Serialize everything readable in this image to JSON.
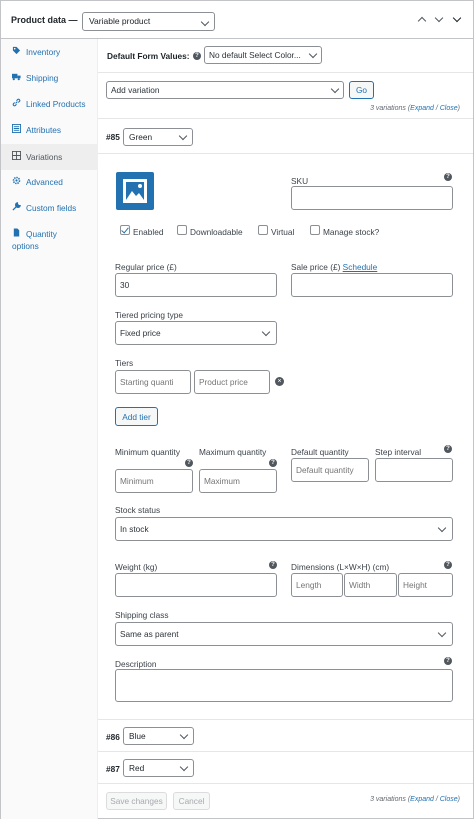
{
  "header": {
    "title": "Product data —",
    "product_type": "Variable product"
  },
  "sidebar": {
    "items": [
      {
        "label": "Inventory",
        "icon": "tag-icon"
      },
      {
        "label": "Shipping",
        "icon": "truck-icon"
      },
      {
        "label": "Linked Products",
        "icon": "link-icon"
      },
      {
        "label": "Attributes",
        "icon": "list-icon"
      },
      {
        "label": "Variations",
        "icon": "grid-icon"
      },
      {
        "label": "Advanced",
        "icon": "gear-icon"
      },
      {
        "label": "Custom fields",
        "icon": "wrench-icon"
      },
      {
        "label": "Quantity",
        "label2": "options",
        "icon": "document-icon"
      }
    ]
  },
  "defaults": {
    "label": "Default Form Values:",
    "value": "No default Select Color..."
  },
  "add_variation": {
    "value": "Add variation",
    "go_label": "Go",
    "summary_prefix": "3 variations (",
    "expand": "Expand",
    "slash": " / ",
    "close": "Close",
    "summary_suffix": ")"
  },
  "variation_85": {
    "id": "#85",
    "color": "Green",
    "sku_label": "SKU",
    "enabled": "Enabled",
    "downloadable": "Downloadable",
    "virtual": "Virtual",
    "manage_stock": "Manage stock?",
    "regular_price_label": "Regular price (£)",
    "regular_price": "30",
    "sale_price_label": "Sale price (£)",
    "schedule": "Schedule",
    "tiered_type_label": "Tiered pricing type",
    "tiered_type": "Fixed price",
    "tiers_label": "Tiers",
    "starting_qty_ph": "Starting quanti",
    "product_price_ph": "Product price",
    "add_tier": "Add tier",
    "min_qty_label": "Minimum quantity",
    "max_qty_label": "Maximum quantity",
    "default_qty_label": "Default quantity",
    "step_label": "Step interval",
    "min_ph": "Minimum",
    "max_ph": "Maximum",
    "default_ph": "Default quantity",
    "stock_status_label": "Stock status",
    "stock_status": "In stock",
    "weight_label": "Weight (kg)",
    "dimensions_label": "Dimensions (L×W×H) (cm)",
    "length_ph": "Length",
    "width_ph": "Width",
    "height_ph": "Height",
    "shipping_class_label": "Shipping class",
    "shipping_class": "Same as parent",
    "description_label": "Description"
  },
  "variation_86": {
    "id": "#86",
    "color": "Blue"
  },
  "variation_87": {
    "id": "#87",
    "color": "Red"
  },
  "footer": {
    "save": "Save changes",
    "cancel": "Cancel"
  },
  "colors": {
    "accent": "#2271b1",
    "border": "#8c8f94",
    "text": "#1d2327"
  }
}
